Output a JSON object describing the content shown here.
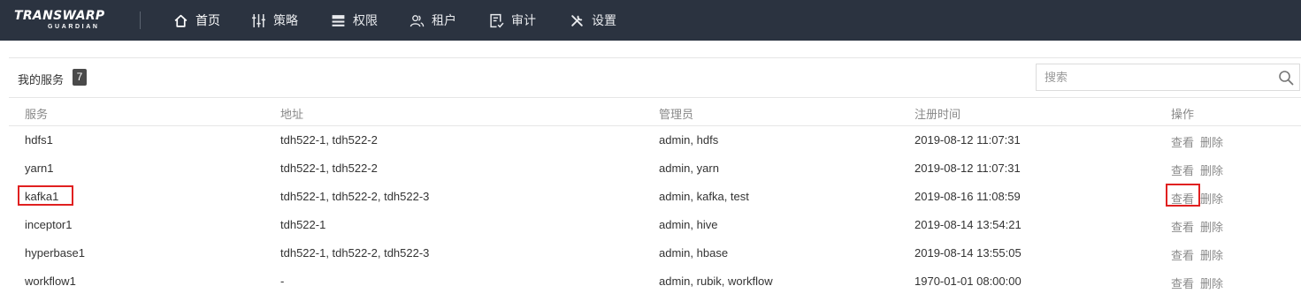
{
  "header": {
    "logo_main": "TRANSWARP",
    "logo_sub": "GUARDIAN",
    "nav": [
      {
        "label": "首页",
        "icon": "home-icon"
      },
      {
        "label": "策略",
        "icon": "sliders-icon"
      },
      {
        "label": "权限",
        "icon": "permissions-icon"
      },
      {
        "label": "租户",
        "icon": "users-icon"
      },
      {
        "label": "审计",
        "icon": "audit-icon"
      },
      {
        "label": "设置",
        "icon": "tools-icon"
      }
    ],
    "active_nav": "首页"
  },
  "services": {
    "title": "我的服务",
    "count": "7",
    "search_placeholder": "搜索",
    "columns": [
      "服务",
      "地址",
      "管理员",
      "注册时间",
      "操作"
    ],
    "rows": [
      {
        "service": "hdfs1",
        "address": "tdh522-1, tdh522-2",
        "admins": "admin, hdfs",
        "registered": "2019-08-12 11:07:31"
      },
      {
        "service": "yarn1",
        "address": "tdh522-1, tdh522-2",
        "admins": "admin, yarn",
        "registered": "2019-08-12 11:07:31"
      },
      {
        "service": "kafka1",
        "address": "tdh522-1, tdh522-2, tdh522-3",
        "admins": "admin, kafka, test",
        "registered": "2019-08-16 11:08:59"
      },
      {
        "service": "inceptor1",
        "address": "tdh522-1",
        "admins": "admin, hive",
        "registered": "2019-08-14 13:54:21"
      },
      {
        "service": "hyperbase1",
        "address": "tdh522-1, tdh522-2, tdh522-3",
        "admins": "admin, hbase",
        "registered": "2019-08-14 13:55:05"
      },
      {
        "service": "workflow1",
        "address": "-",
        "admins": "admin, rubik, workflow",
        "registered": "1970-01-01 08:00:00"
      }
    ],
    "actions": {
      "view": "查看",
      "delete": "删除"
    },
    "highlighted_row": "kafka1",
    "highlight_color": "#e02020"
  },
  "colors": {
    "topbar_bg": "#2b3340",
    "action_text": "#8a8a8a",
    "header_text": "#888888"
  }
}
